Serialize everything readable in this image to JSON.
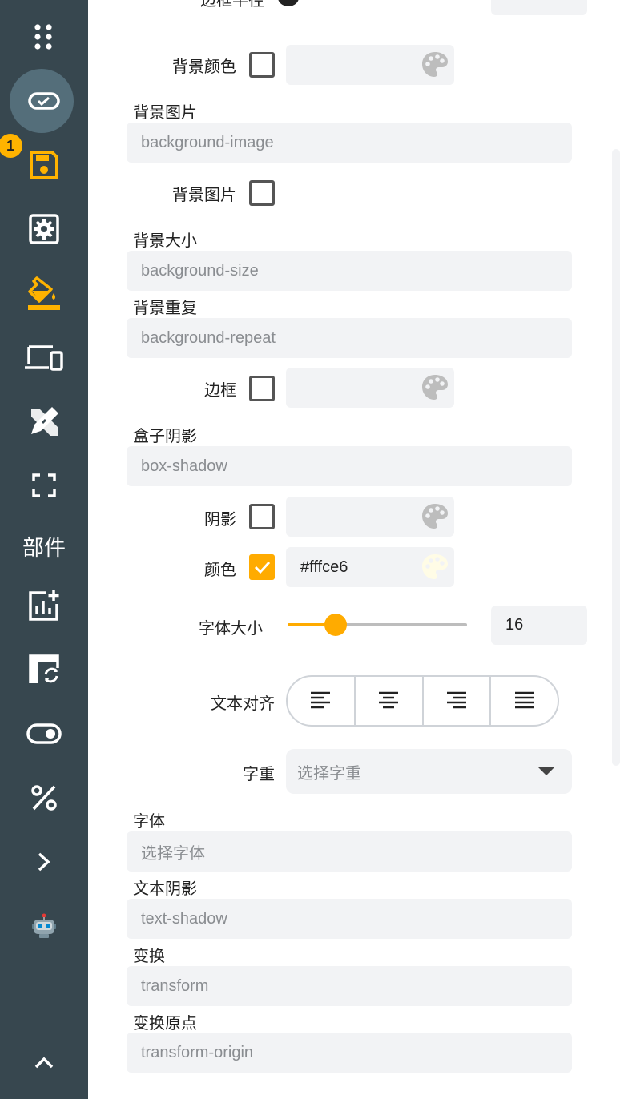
{
  "sidebar": {
    "badge_count": "1",
    "widgets_label": "部件",
    "items": [
      {
        "icon": "apps-grid-icon"
      },
      {
        "icon": "toggle-check-icon",
        "active": true
      },
      {
        "icon": "save-icon",
        "color": "#ffb300"
      },
      {
        "icon": "settings-icon"
      },
      {
        "icon": "paint-bucket-icon",
        "color": "#ffb300"
      },
      {
        "icon": "devices-icon"
      },
      {
        "icon": "design-tools-icon"
      },
      {
        "icon": "fullscreen-icon"
      },
      {
        "icon": "add-chart-icon"
      },
      {
        "icon": "swap-layout-icon"
      },
      {
        "icon": "toggle-icon"
      },
      {
        "icon": "percent-icon"
      },
      {
        "icon": "chevron-right-icon"
      },
      {
        "icon": "robot-icon"
      },
      {
        "icon": "chevron-up-icon"
      }
    ]
  },
  "form": {
    "top_partial_label": "边框半径",
    "bg_color": {
      "label": "背景颜色",
      "checked": false,
      "value": ""
    },
    "bg_image": {
      "label": "背景图片",
      "placeholder": "background-image"
    },
    "bg_image_check": {
      "label": "背景图片",
      "checked": false
    },
    "bg_size": {
      "label": "背景大小",
      "placeholder": "background-size"
    },
    "bg_repeat": {
      "label": "背景重复",
      "placeholder": "background-repeat"
    },
    "border": {
      "label": "边框",
      "checked": false,
      "value": ""
    },
    "box_shadow": {
      "label": "盒子阴影",
      "placeholder": "box-shadow"
    },
    "shadow": {
      "label": "阴影",
      "checked": false,
      "value": ""
    },
    "color": {
      "label": "颜色",
      "checked": true,
      "value": "#fffce6"
    },
    "font_size": {
      "label": "字体大小",
      "value": "16",
      "slider_fraction": 0.27
    },
    "text_align": {
      "label": "文本对齐",
      "options": [
        "left",
        "center",
        "right",
        "justify"
      ]
    },
    "font_weight": {
      "label": "字重",
      "placeholder": "选择字重"
    },
    "font_family": {
      "label": "字体",
      "placeholder": "选择字体"
    },
    "text_shadow": {
      "label": "文本阴影",
      "placeholder": "text-shadow"
    },
    "transform": {
      "label": "变换",
      "placeholder": "transform"
    },
    "transform_origin": {
      "label": "变换原点",
      "placeholder": "transform-origin"
    }
  },
  "colors": {
    "sidebar_bg": "#37474f",
    "accent": "#ffab00",
    "field_bg": "#f2f3f5",
    "palette_gray": "#bdbdbd",
    "palette_light": "#fffce6"
  }
}
